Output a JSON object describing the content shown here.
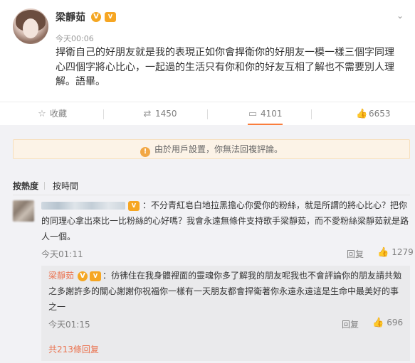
{
  "post": {
    "author": "梁靜茹",
    "time": "今天00:06",
    "text": "捍衛自己的好朋友就是我的表現正如你會捍衛你的好朋友一模一樣三個字同理心四個字將心比心，一起過的生活只有你和你的好友互相了解也不需要別人理解。語畢。"
  },
  "badges": {
    "verified": "V",
    "vip": "VIP"
  },
  "actions": {
    "favorite": {
      "label": "收藏",
      "icon": "star-icon"
    },
    "repost": {
      "count": "1450",
      "icon": "repost-icon"
    },
    "comment": {
      "count": "4101",
      "icon": "comment-icon"
    },
    "like": {
      "count": "6653",
      "icon": "thumb-up-icon"
    }
  },
  "notice": {
    "text": "由於用戶設置，你無法回複評論。",
    "icon": "warning-icon"
  },
  "sort": {
    "by_hot": "按熱度",
    "by_time": "按時間"
  },
  "comments": [
    {
      "text": "：不分青紅皂白地拉黑擔心你愛你的粉絲，就是所謂的將心比心？把你的同理心拿出來比一比粉絲的心好嗎？我會永遠無條件支持歌手梁靜茹，而不愛粉絲梁靜茹就是路人一個。",
      "time": "今天01:11",
      "reply_label": "回复",
      "likes": "1279",
      "reply": {
        "author": "梁靜茹",
        "text": "：彷彿住在我身體裡面的靈魂你多了解我的朋友呢我也不會評論你的朋友請共勉之多謝許多的關心謝謝你祝福你一樣有一天朋友都會捍衛著你永遠永遠這是生命中最美好的事之一",
        "time": "今天01:15",
        "reply_label": "回复",
        "likes": "696"
      },
      "total_replies": "共213條回复"
    }
  ],
  "colors": {
    "accent": "#eb7350",
    "notice_bg": "#fcf3e7",
    "badge": "#f4a723"
  }
}
